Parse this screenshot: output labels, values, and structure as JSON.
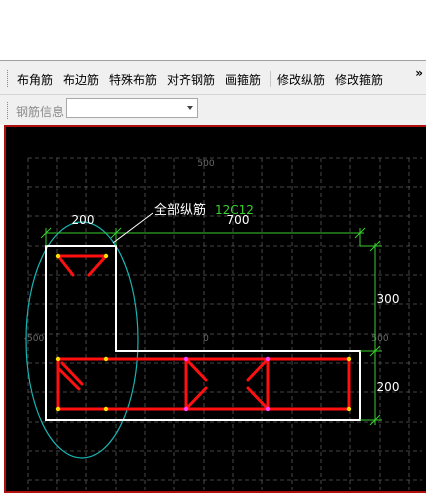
{
  "toolbar": {
    "buttons": [
      "布角筋",
      "布边筋",
      "特殊布筋",
      "对齐钢筋",
      "画箍筋",
      "修改纵筋",
      "修改箍筋"
    ],
    "overflow": "»"
  },
  "info_bar": {
    "label": "钢筋信息",
    "select_value": ""
  },
  "drawing": {
    "axis_labels": [
      "500",
      "-500",
      "0",
      "500"
    ],
    "dim_top_left": "200",
    "dim_top_right": "700",
    "dim_right_upper": "300",
    "dim_right_lower": "200",
    "annotation_label": "全部纵筋",
    "annotation_value": "12C12",
    "colors": {
      "background": "#000000",
      "grid": "#5a5a5a",
      "outline": "#ffffff",
      "rebar": "#ff1010",
      "dimension": "#39d12f",
      "ellipse": "#19b4b4",
      "point": "#ffe000",
      "tie_point": "#ff40ff",
      "axis_text": "#6a6a6a",
      "annotation_value": "#39d12f"
    }
  }
}
